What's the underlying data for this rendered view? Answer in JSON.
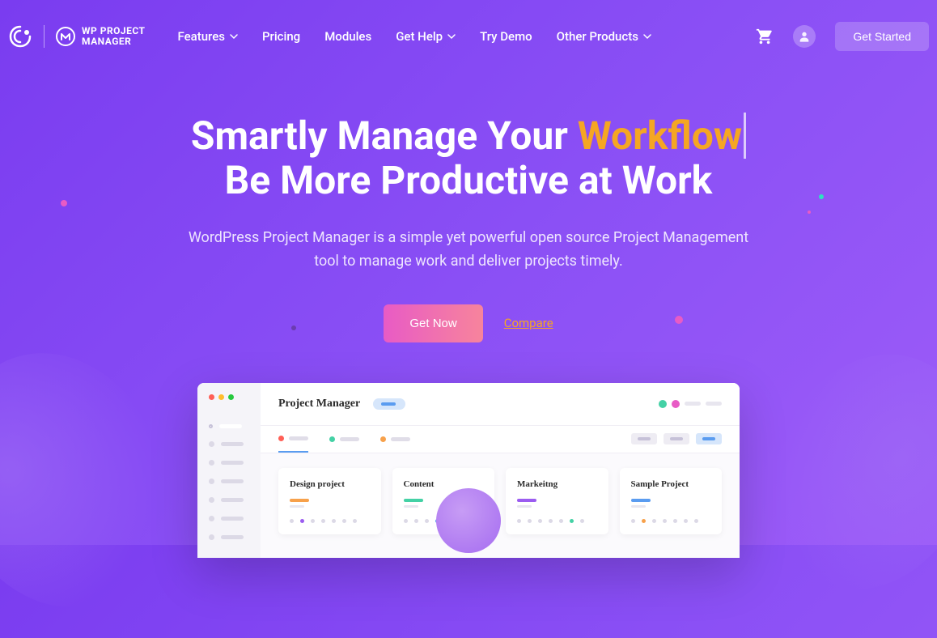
{
  "logo": {
    "line1": "WP PROJECT",
    "line2": "MANAGER"
  },
  "nav": {
    "features": "Features",
    "pricing": "Pricing",
    "modules": "Modules",
    "get_help": "Get Help",
    "try_demo": "Try Demo",
    "other_products": "Other Products"
  },
  "header": {
    "get_started": "Get Started"
  },
  "hero": {
    "title_pre": "Smartly Manage Your ",
    "title_highlight": "Workflow",
    "title_line2": "Be More Productive at Work",
    "subtitle": "WordPress Project Manager is a simple yet powerful open source Project Management tool to manage work and deliver projects timely.",
    "cta_primary": "Get Now",
    "cta_secondary": "Compare"
  },
  "mockup": {
    "title": "Project Manager",
    "cards": [
      {
        "title": "Design project",
        "color": "#f7a14b"
      },
      {
        "title": "Content",
        "color": "#44d1a5"
      },
      {
        "title": "Markeitng",
        "color": "#9b5cf0"
      },
      {
        "title": "Sample Project",
        "color": "#5a9cf0"
      }
    ],
    "tab_colors": [
      "#ff5f56",
      "#44d1a5",
      "#f7a14b"
    ],
    "header_circles": [
      "#44d1a5",
      "#e85bc5"
    ]
  }
}
